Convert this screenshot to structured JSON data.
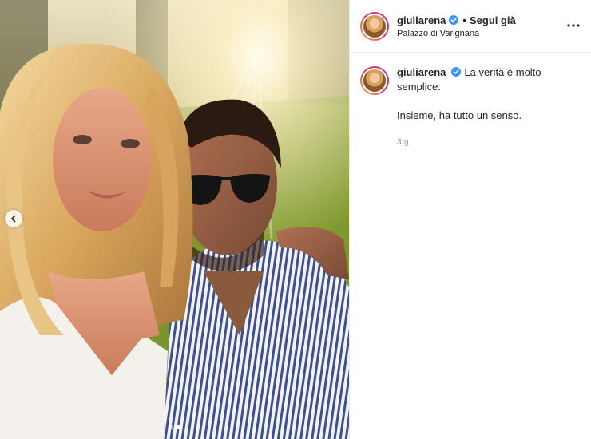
{
  "post": {
    "username": "giuliarena",
    "follow_separator": "•",
    "follow_state": "Segui già",
    "location": "Palazzo di Varignana",
    "more_icon": "more-horizontal-icon"
  },
  "caption": {
    "username": "giuliarena",
    "text_line1": "La verità è molto semplice:",
    "text_line2": "Insieme, ha tutto un senso.",
    "timestamp": "3 g"
  },
  "media": {
    "carousel_dots": 2,
    "active_dot": 1,
    "prev_icon": "chevron-left-icon"
  },
  "colors": {
    "verified_blue": "#3897f0",
    "text": "#262626",
    "muted": "#8e8e8e"
  }
}
